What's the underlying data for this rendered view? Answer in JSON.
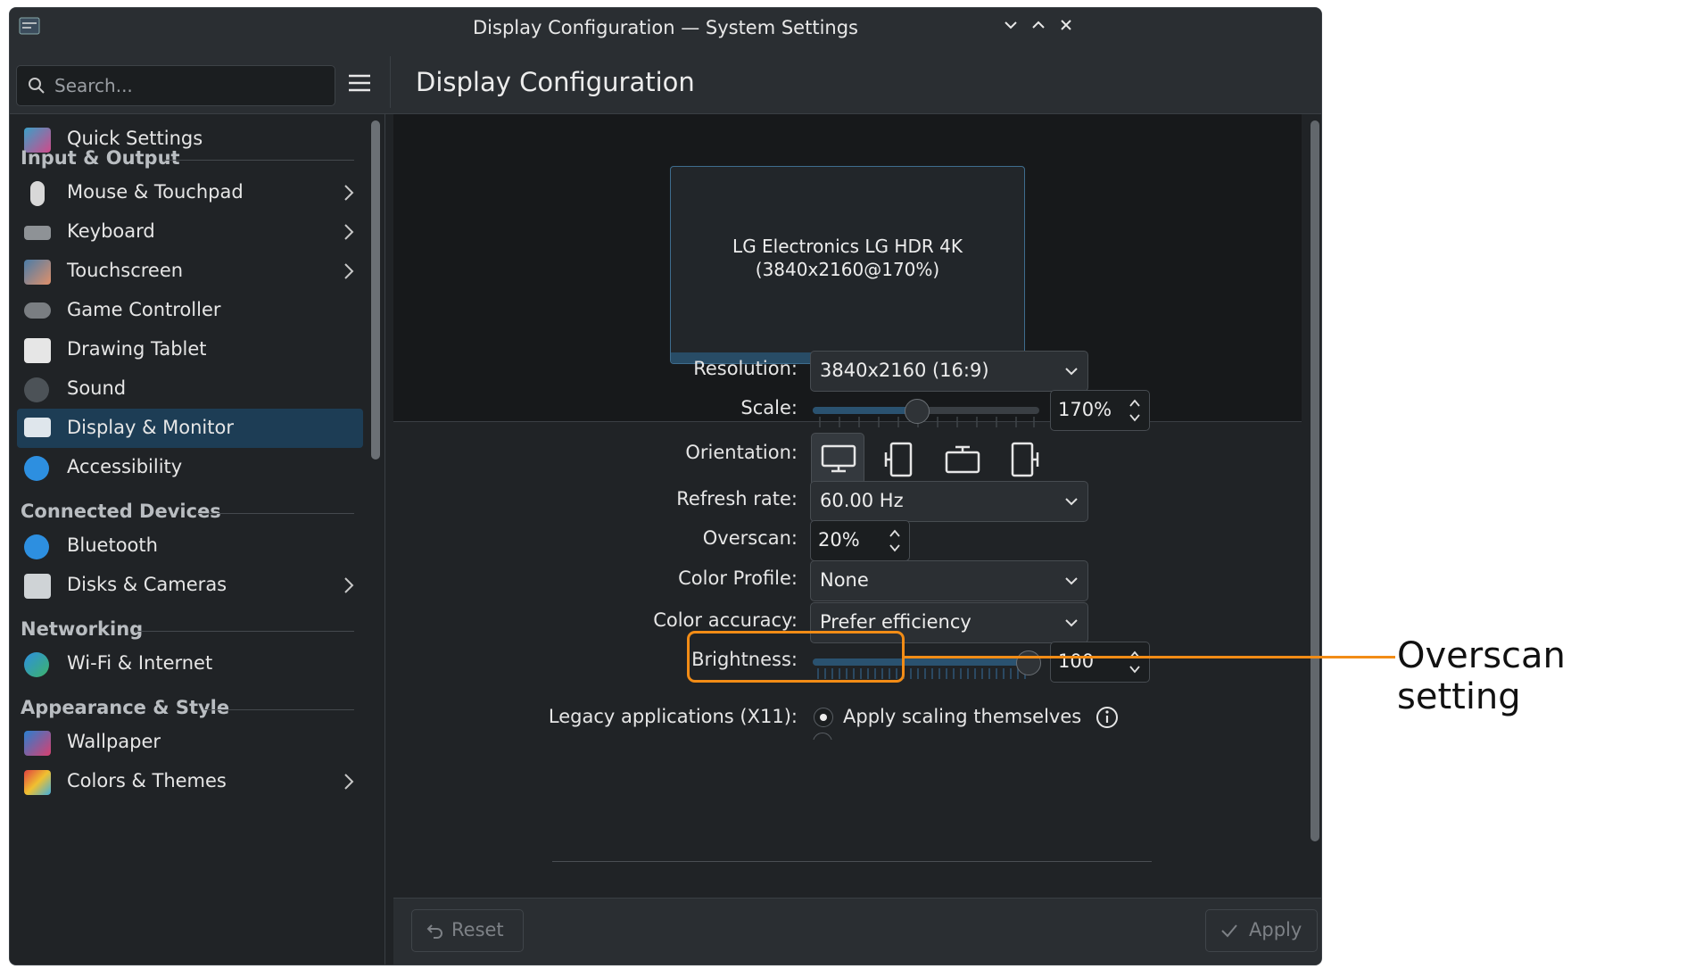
{
  "window": {
    "title": "Display Configuration — System Settings"
  },
  "toolbar": {
    "search_placeholder": "Search...",
    "page_title": "Display Configuration"
  },
  "sidebar": {
    "quick_settings": "Quick Settings",
    "sections": {
      "input_output": "Input & Output",
      "connected_devices": "Connected Devices",
      "networking": "Networking",
      "appearance": "Appearance & Style"
    },
    "items": [
      {
        "label": "Mouse & Touchpad",
        "icon": "mouse-icon"
      },
      {
        "label": "Keyboard",
        "icon": "keyboard-icon"
      },
      {
        "label": "Touchscreen",
        "icon": "touchscreen-icon"
      },
      {
        "label": "Game Controller",
        "icon": "gamepad-icon"
      },
      {
        "label": "Drawing Tablet",
        "icon": "tablet-icon"
      },
      {
        "label": "Sound",
        "icon": "speaker-icon"
      },
      {
        "label": "Display & Monitor",
        "icon": "monitor-icon",
        "active": true
      },
      {
        "label": "Accessibility",
        "icon": "accessibility-icon"
      },
      {
        "label": "Bluetooth",
        "icon": "bluetooth-icon"
      },
      {
        "label": "Disks & Cameras",
        "icon": "disk-icon"
      },
      {
        "label": "Wi-Fi & Internet",
        "icon": "globe-icon"
      },
      {
        "label": "Wallpaper",
        "icon": "wallpaper-icon"
      },
      {
        "label": "Colors & Themes",
        "icon": "palette-icon"
      }
    ]
  },
  "preview": {
    "monitor_name": "LG Electronics LG HDR 4K",
    "monitor_mode": "(3840x2160@170%)"
  },
  "settings": {
    "resolution_label": "Resolution:",
    "resolution_value": "3840x2160 (16:9)",
    "scale_label": "Scale:",
    "scale_value": "170%",
    "scale_level": 0.45,
    "orientation_label": "Orientation:",
    "refresh_label": "Refresh rate:",
    "refresh_value": "60.00 Hz",
    "overscan_label": "Overscan:",
    "overscan_value": "20%",
    "color_profile_label": "Color Profile:",
    "color_profile_value": "None",
    "color_accuracy_label": "Color accuracy:",
    "color_accuracy_value": "Prefer efficiency",
    "brightness_label": "Brightness:",
    "brightness_value": "100",
    "brightness_level": 1.0,
    "legacy_label": "Legacy applications (X11):",
    "legacy_option": "Apply scaling themselves"
  },
  "footer": {
    "reset_label": "Reset",
    "apply_label": "Apply"
  },
  "annotation": {
    "callout_text": "Overscan setting",
    "color": "#f28c16"
  },
  "colors": {
    "accent": "#1d3d55",
    "background": "#202326"
  }
}
